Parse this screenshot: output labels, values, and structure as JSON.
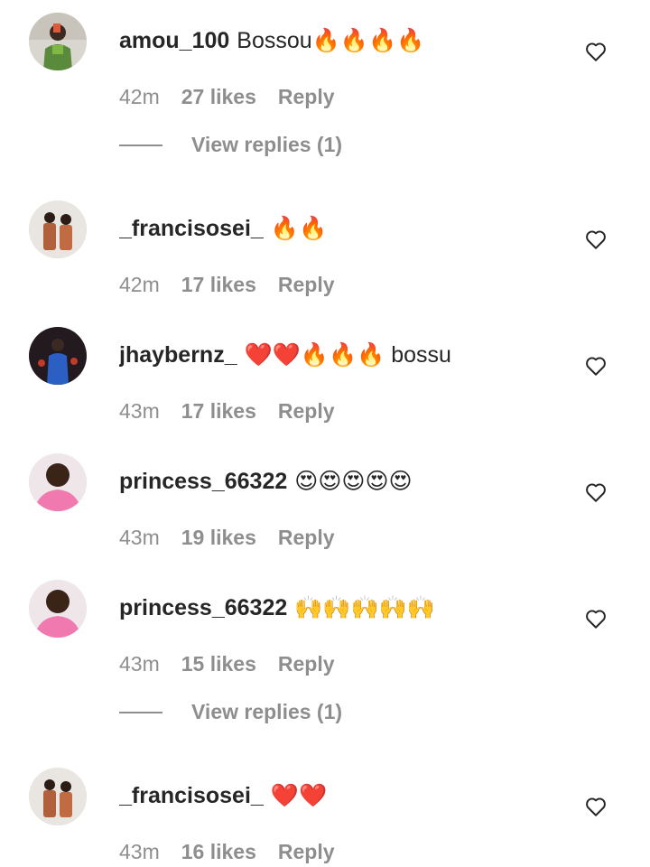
{
  "colors": {
    "text_primary": "#262626",
    "text_secondary": "#8e8e8e",
    "background": "#ffffff"
  },
  "comments": [
    {
      "username": "amou_100",
      "text": "Bossou🔥🔥🔥🔥",
      "time": "42m",
      "likes": "27 likes",
      "reply": "Reply",
      "view_replies": "View replies (1)",
      "avatar": "avatar-photo"
    },
    {
      "username": "_francisosei_",
      "text": "🔥🔥",
      "time": "42m",
      "likes": "17 likes",
      "reply": "Reply",
      "avatar": "avatar-photo"
    },
    {
      "username": "jhaybernz_",
      "text": "❤️❤️🔥🔥🔥 bossu",
      "time": "43m",
      "likes": "17 likes",
      "reply": "Reply",
      "avatar": "avatar-photo"
    },
    {
      "username": "princess_66322",
      "text": "😍😍😍😍😍",
      "time": "43m",
      "likes": "19 likes",
      "reply": "Reply",
      "avatar": "avatar-photo"
    },
    {
      "username": "princess_66322",
      "text": "🙌🙌🙌🙌🙌",
      "time": "43m",
      "likes": "15 likes",
      "reply": "Reply",
      "view_replies": "View replies (1)",
      "avatar": "avatar-photo"
    },
    {
      "username": "_francisosei_",
      "text": "❤️❤️",
      "time": "43m",
      "likes": "16 likes",
      "reply": "Reply",
      "avatar": "avatar-photo"
    }
  ],
  "icons": {
    "like": "heart-outline-icon"
  }
}
